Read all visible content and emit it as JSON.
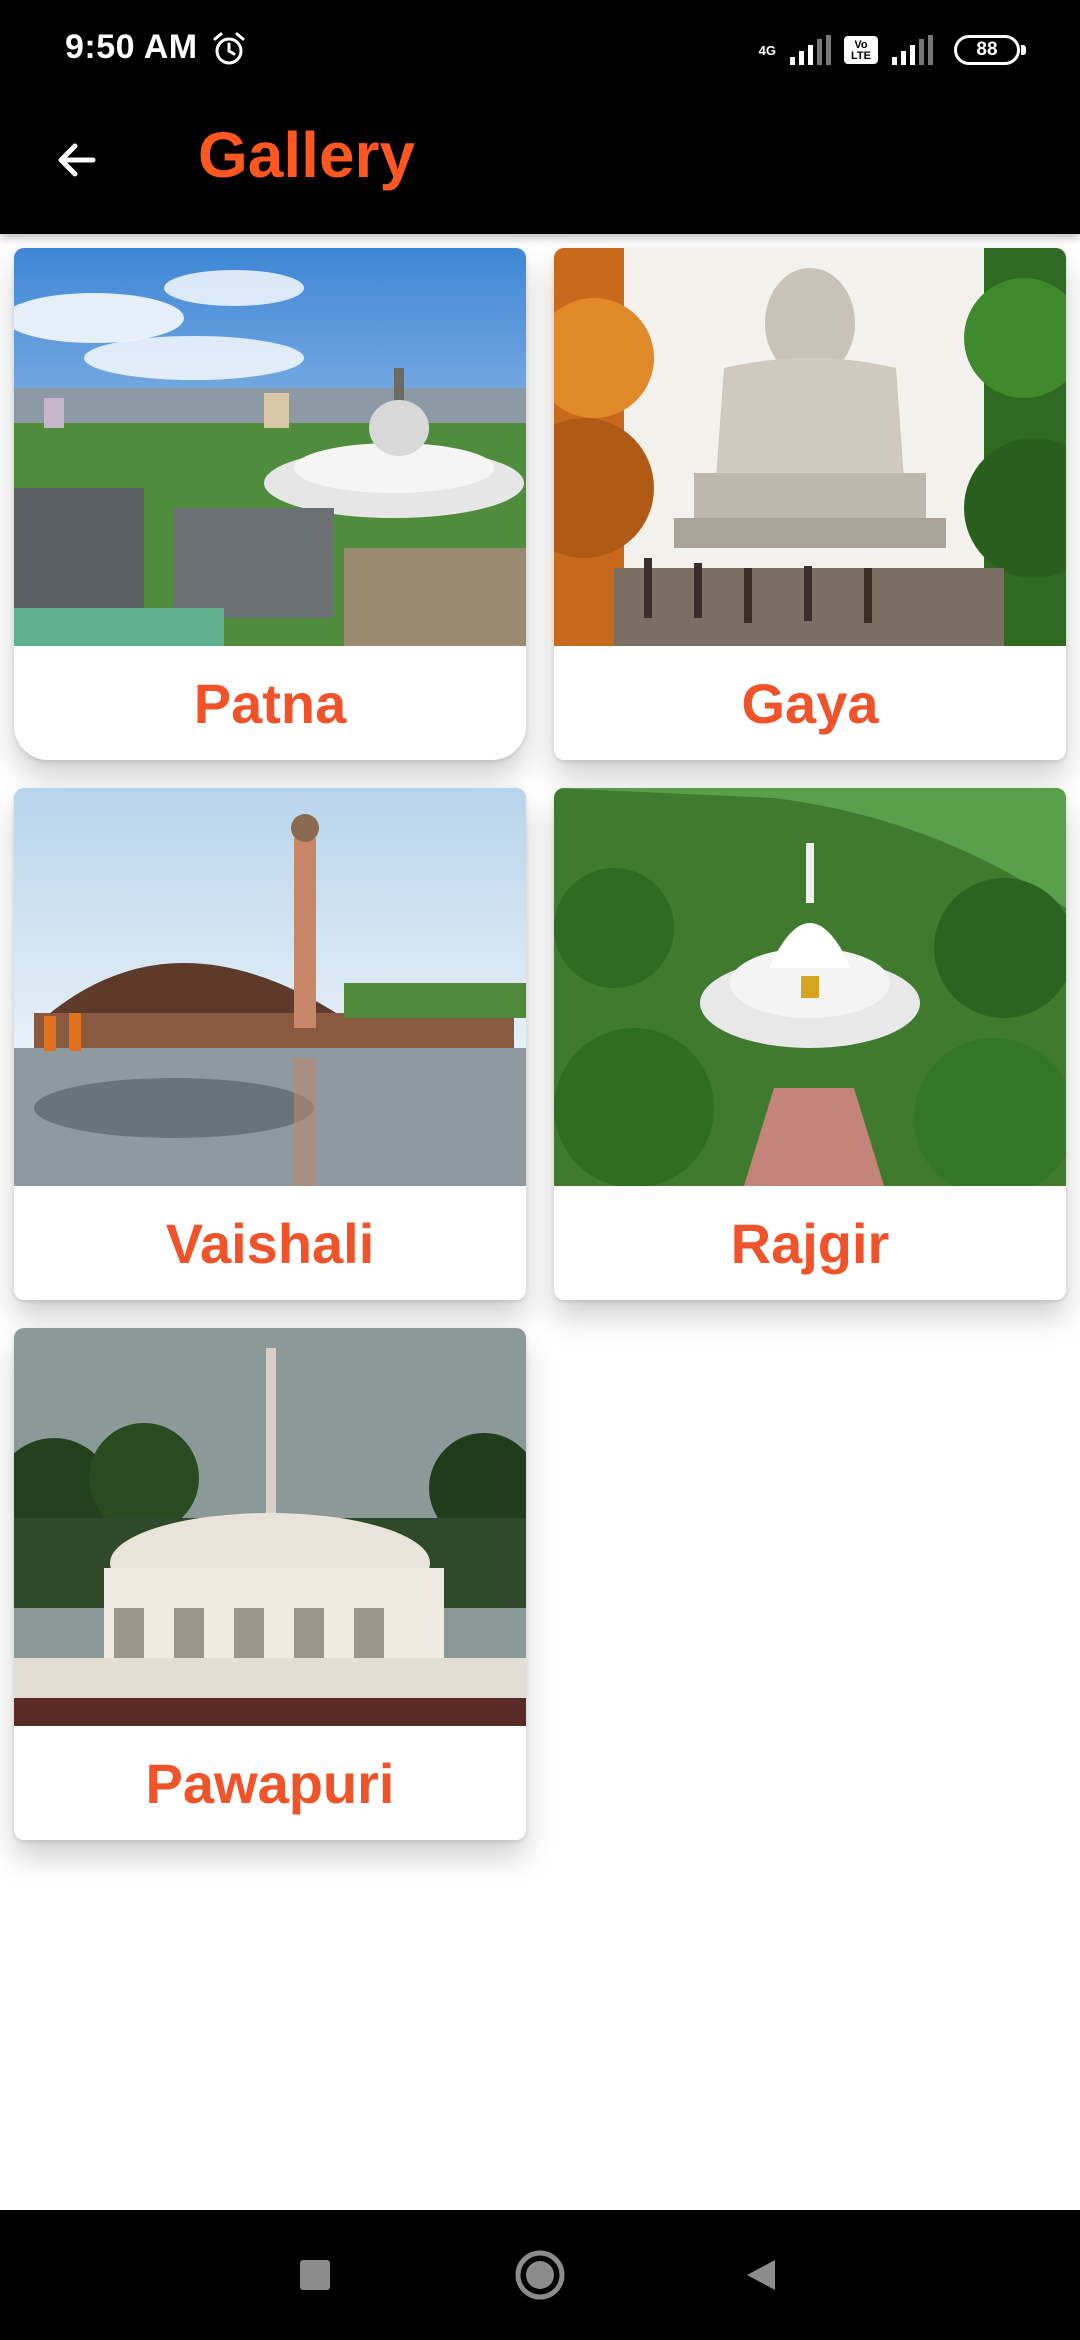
{
  "status_bar": {
    "time": "9:50 AM",
    "network_label": "4G",
    "volte_label": "Vo LTE",
    "battery_level": "88"
  },
  "app_bar": {
    "title": "Gallery",
    "accent_color": "#ff5722",
    "background_color": "#000000"
  },
  "gallery": {
    "label_color": "#f0522a",
    "items": [
      {
        "label": "Patna"
      },
      {
        "label": "Gaya"
      },
      {
        "label": "Vaishali"
      },
      {
        "label": "Rajgir"
      },
      {
        "label": "Pawapuri"
      }
    ]
  },
  "nav_bar": {
    "buttons": [
      "recents-icon",
      "home-icon",
      "back-icon"
    ]
  }
}
